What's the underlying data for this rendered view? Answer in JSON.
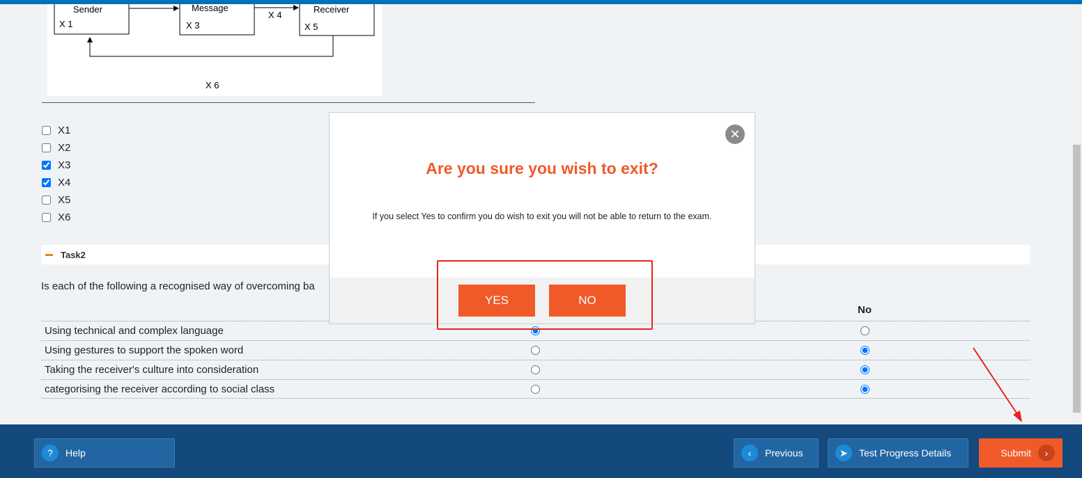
{
  "diagram": {
    "sender": "Sender",
    "message": "Message",
    "receiver": "Receiver",
    "x1": "X 1",
    "x3": "X 3",
    "x4": "X 4",
    "x5": "X 5",
    "x6": "X 6"
  },
  "options": [
    {
      "label": "X1",
      "checked": false
    },
    {
      "label": "X2",
      "checked": false
    },
    {
      "label": "X3",
      "checked": true
    },
    {
      "label": "X4",
      "checked": true
    },
    {
      "label": "X5",
      "checked": false
    },
    {
      "label": "X6",
      "checked": false
    }
  ],
  "task": {
    "title": "Task2",
    "question": "Is each of the following a recognised way of overcoming ba",
    "col_no": "No",
    "rows": [
      {
        "text": "Using technical and complex language",
        "answer": "yes"
      },
      {
        "text": "Using gestures to support the spoken word",
        "answer": "no"
      },
      {
        "text": "Taking the receiver's culture into consideration",
        "answer": "no"
      },
      {
        "text": "categorising the receiver according to social class",
        "answer": "no"
      }
    ]
  },
  "modal": {
    "title": "Are you sure you wish to exit?",
    "message": "If you select Yes to confirm you do wish to exit you will not be able to return to the exam.",
    "yes": "YES",
    "no": "NO",
    "close_icon": "close-icon"
  },
  "footer": {
    "help": "Help",
    "previous": "Previous",
    "progress": "Test Progress Details",
    "submit": "Submit"
  },
  "colors": {
    "accent": "#f05a28",
    "footer": "#14497d",
    "annotation": "#e8231b"
  }
}
